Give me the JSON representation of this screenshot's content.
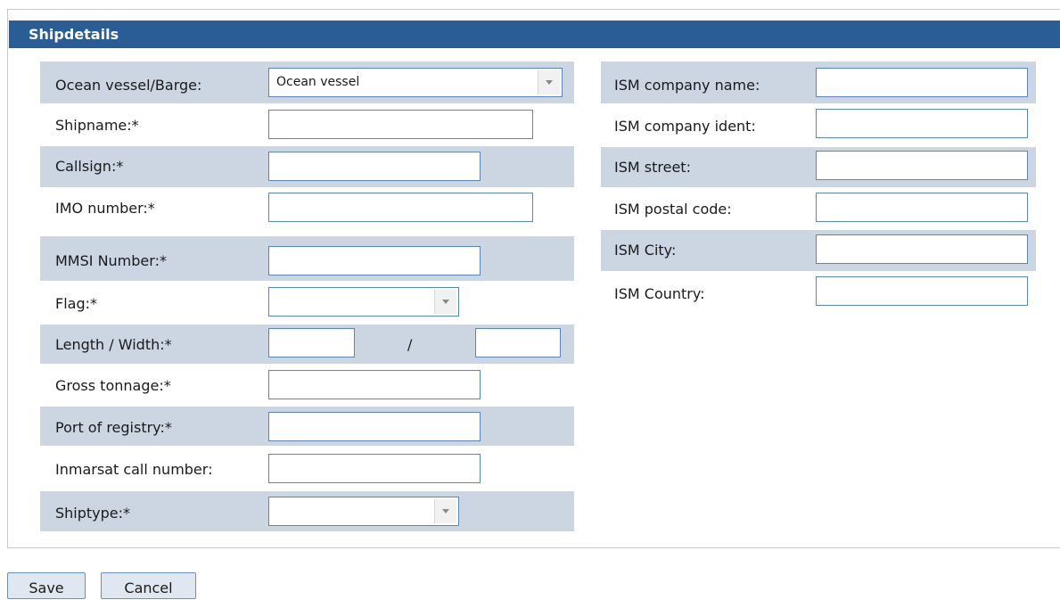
{
  "panel": {
    "title": "Shipdetails"
  },
  "left_form": {
    "vessel_type": {
      "label": "Ocean vessel/Barge:",
      "value": "Ocean vessel"
    },
    "shipname": {
      "label": "Shipname:*",
      "value": ""
    },
    "callsign": {
      "label": "Callsign:*",
      "value": ""
    },
    "imo_number": {
      "label": "IMO number:*",
      "value": ""
    },
    "mmsi_number": {
      "label": "MMSI Number:*",
      "value": ""
    },
    "flag": {
      "label": "Flag:*",
      "value": ""
    },
    "length_width": {
      "label": "Length / Width:*",
      "separator": "/",
      "length_value": "",
      "width_value": ""
    },
    "gross_tonnage": {
      "label": "Gross tonnage:*",
      "value": ""
    },
    "port_of_registry": {
      "label": "Port of registry:*",
      "value": ""
    },
    "inmarsat": {
      "label": "Inmarsat call number:",
      "value": ""
    },
    "shiptype": {
      "label": "Shiptype:*",
      "value": ""
    }
  },
  "right_form": {
    "ism_company_name": {
      "label": "ISM company name:",
      "value": ""
    },
    "ism_company_ident": {
      "label": "ISM company ident:",
      "value": ""
    },
    "ism_street": {
      "label": "ISM street:",
      "value": ""
    },
    "ism_postal_code": {
      "label": "ISM postal code:",
      "value": ""
    },
    "ism_city": {
      "label": "ISM City:",
      "value": ""
    },
    "ism_country": {
      "label": "ISM Country:",
      "value": ""
    }
  },
  "buttons": {
    "save": "Save",
    "cancel": "Cancel"
  },
  "colors": {
    "header": "#2a5d95",
    "stripe": "#ccd6e3",
    "field_border": "#5a85b4"
  }
}
